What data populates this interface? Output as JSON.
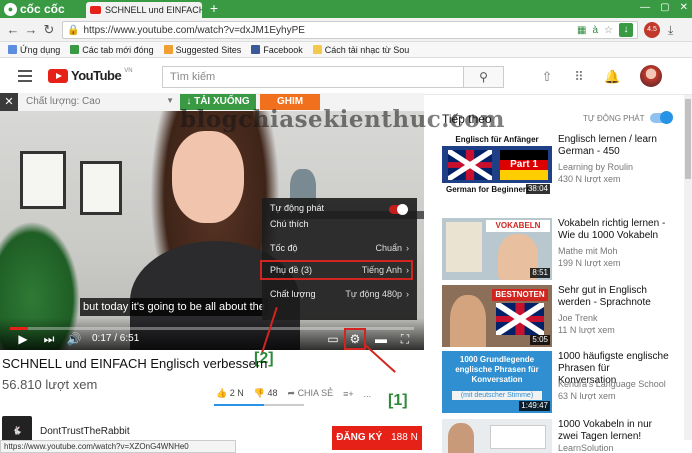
{
  "browser": {
    "brand": "cốc cốc",
    "tab_title": "SCHNELL und EINFACH En",
    "url": "https://www.youtube.com/watch?v=dxJM1EyhyPE",
    "badge": "4.5"
  },
  "bookmarks": [
    {
      "label": "Ứng dụng",
      "color": "#5c8de0"
    },
    {
      "label": "Các tab mới đóng",
      "color": "#3a9a44"
    },
    {
      "label": "Suggested Sites",
      "color": "#f0a030"
    },
    {
      "label": "Facebook",
      "color": "#3b5998"
    },
    {
      "label": "Cách tải nhạc từ Sou",
      "color": "#f2c94c"
    }
  ],
  "youtube": {
    "logo": "YouTube",
    "logo_region": "VN",
    "search_placeholder": "Tìm kiếm"
  },
  "download_bar": {
    "quality": "Chất lượng: Cao",
    "download_label": "↓ TẢI XUỐNG",
    "save_label": "GHIM"
  },
  "player": {
    "subtitle": "but today it's going to be all about the",
    "time": "0:17 / 6:51",
    "progress": 0.044,
    "settings": {
      "autoplay": "Tự động phát",
      "annotations": "Chú thích",
      "speed": "Tốc độ",
      "speed_value": "Chuẩn",
      "subtitles": "Phụ đề (3)",
      "subtitles_value": "Tiếng Anh",
      "quality": "Chất lượng",
      "quality_value": "Tự động 480p"
    }
  },
  "annotations": {
    "label_1": "[1]",
    "label_2": "[2]",
    "watermark": "blogchiasekienthuc.com"
  },
  "video": {
    "title": "SCHNELL und EINFACH Englisch verbessern",
    "views": "56.810 lượt xem",
    "likes": "2 N",
    "dislikes": "48",
    "share": "CHIA SẺ",
    "more": "...",
    "channel": "DontTrustTheRabbit",
    "subscribe": "ĐĂNG KÝ",
    "subscribers": "188 N"
  },
  "status_url": "https://www.youtube.com/watch?v=XZOnG4WNHe0",
  "sidebar": {
    "heading": "Tiếp theo",
    "autoplay": "TỰ ĐỘNG PHÁT",
    "items": [
      {
        "title": "Englisch lernen / learn German - 450",
        "channel": "Learning by Roulin",
        "views": "430 N lượt xem",
        "duration": "38:04",
        "thumb_text": "Englisch für Anfänger Part 1 German for Beginners"
      },
      {
        "title": "Vokabeln richtig lernen - Wie du 1000 Vokabeln",
        "channel": "Mathe mit Moh",
        "views": "199 N lượt xem",
        "duration": "8:51",
        "thumb_text": "VOKABELN RICHTIG LERNEN"
      },
      {
        "title": "Sehr gut in Englisch werden - Sprachnote",
        "channel": "Joe Trenk",
        "views": "11 N lượt xem",
        "duration": "5:05",
        "thumb_text": "BESTNOTEN IN ENGLISCH"
      },
      {
        "title": "1000 häufigste englische Phrasen für Konversation",
        "channel": "Kendra's Language School",
        "views": "63 N lượt xem",
        "duration": "1:49:47",
        "thumb_text": "1000 Grundlegende englische Phrasen für Konversation (mit deutscher Stimme)"
      },
      {
        "title": "1000 Vokabeln in nur zwei Tagen lernen!",
        "channel": "LearnSolution",
        "views": "",
        "duration": "",
        "thumb_text": ""
      }
    ]
  }
}
